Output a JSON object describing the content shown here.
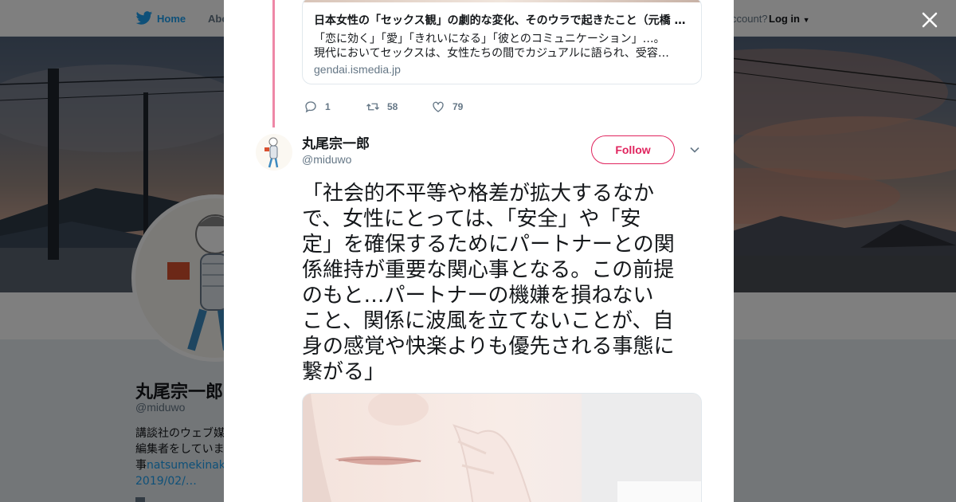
{
  "topbar": {
    "home_label": "Home",
    "about_label": "Abo",
    "account_label": "ccount?",
    "login_label": "Log in"
  },
  "profile": {
    "name": "丸尾宗一郎",
    "handle": "@miduwo",
    "bio_line1": "講談社のウェブ媒",
    "bio_line2": "編集者をしていま",
    "bio_line3_prefix": "事",
    "bio_line3_link": "natsumekinako",
    "bio_line4": "2019/02/…"
  },
  "card": {
    "title": "日本女性の「セックス観」の劇的な変化、そのウラで起きたこと（元橋 …",
    "desc_line1": "「恋に効く」「愛」「きれいになる」「彼とのコミュニケーション」…。",
    "desc_line2": "現代においてセックスは、女性たちの間でカジュアルに語られ、受容…",
    "domain": "gendai.ismedia.jp"
  },
  "actions": {
    "replies": "1",
    "retweets": "58",
    "likes": "79"
  },
  "tweet": {
    "author_name": "丸尾宗一郎",
    "author_handle": "@miduwo",
    "follow_label": "Follow",
    "lines": [
      "「社会的不平等や格差が拡大するなか",
      "で、女性にとっては、「安全」や「安",
      "定」を確保するためにパートナーとの関",
      "係維持が重要な関心事となる。この前提",
      "のもと…パートナーの機嫌を損ねない",
      "こと、関係に波風を立てないことが、自",
      "身の感覚や快楽よりも優先される事態に",
      "繋がる」"
    ]
  },
  "colors": {
    "accent": "#e0245e",
    "twitter_blue": "#1da1f2",
    "muted": "#657786",
    "text": "#14171a"
  },
  "icons": {
    "close": "close-icon",
    "reply": "reply-icon",
    "retweet": "retweet-icon",
    "like": "heart-icon",
    "caret": "chevron-down-icon",
    "brand": "twitter-bird-icon"
  }
}
